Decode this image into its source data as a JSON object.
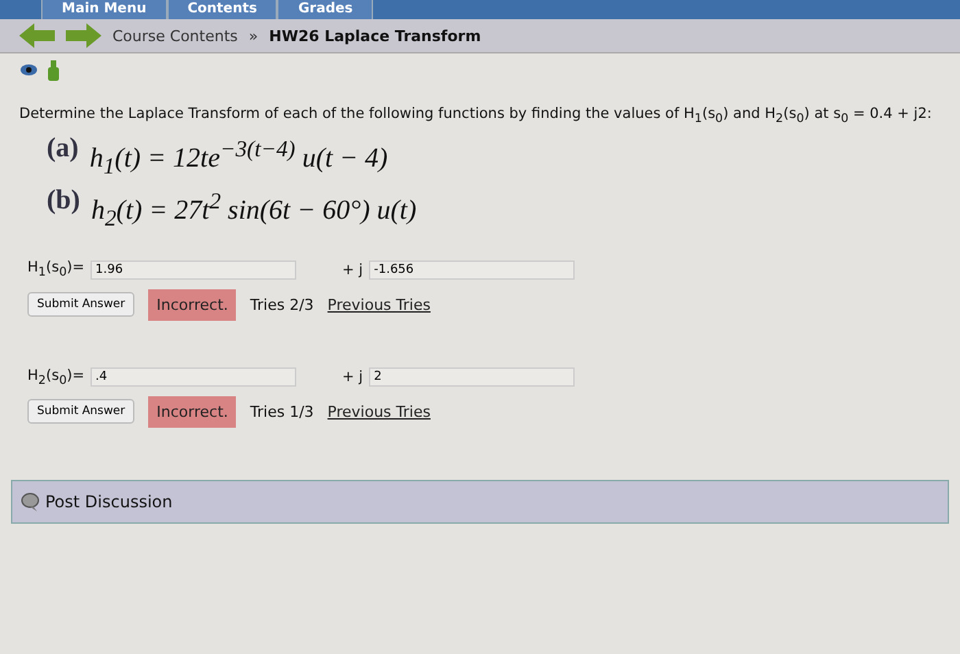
{
  "top_tabs": [
    "Main Menu",
    "Contents",
    "Grades"
  ],
  "breadcrumb": {
    "parent": "Course Contents",
    "separator": "»",
    "current": "HW26 Laplace Transform"
  },
  "problem": {
    "prompt": "Determine the Laplace Transform of each of the following functions by finding the values of H$_{1}$(s$_{0}$) and H$_{2}$(s$_{0}$) at s$_{0}$ = 0.4 + j2:",
    "parts": [
      {
        "label": "(a)",
        "formula": "h$_{1}$(t) = 12te$^{−3(t−4)}$ u(t − 4)"
      },
      {
        "label": "(b)",
        "formula": "h$_{2}$(t) = 27t$^{2}$ sin(6t − 60°) u(t)"
      }
    ]
  },
  "answers": [
    {
      "label": "H$_{1}$(s$_{0}$)=",
      "real": "1.96",
      "imag_label": "+ j",
      "imag": "-1.656",
      "button": "Submit Answer",
      "status": "Incorrect.",
      "tries": "Tries 2/3",
      "link": "Previous Tries"
    },
    {
      "label": "H$_{2}$(s$_{0}$)=",
      "real": ".4",
      "imag_label": "+ j",
      "imag": "2",
      "button": "Submit Answer",
      "status": "Incorrect.",
      "tries": "Tries 1/3",
      "link": "Previous Tries"
    }
  ],
  "discussion": "Post Discussion"
}
